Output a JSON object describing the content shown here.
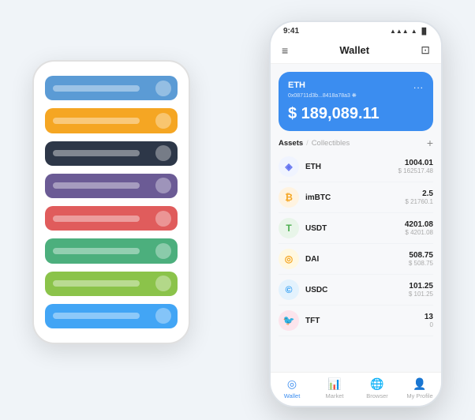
{
  "scene": {
    "back_phone": {
      "cards": [
        {
          "id": "card-1",
          "color_class": "card-blue"
        },
        {
          "id": "card-2",
          "color_class": "card-orange"
        },
        {
          "id": "card-3",
          "color_class": "card-dark"
        },
        {
          "id": "card-4",
          "color_class": "card-purple"
        },
        {
          "id": "card-5",
          "color_class": "card-red"
        },
        {
          "id": "card-6",
          "color_class": "card-green"
        },
        {
          "id": "card-7",
          "color_class": "card-light-green"
        },
        {
          "id": "card-8",
          "color_class": "card-light-blue"
        }
      ]
    },
    "front_phone": {
      "status_bar": {
        "time": "9:41",
        "signal": "▲",
        "wifi": "WiFi",
        "battery": "🔋"
      },
      "header": {
        "menu_icon": "≡",
        "title": "Wallet",
        "scan_icon": "⊡"
      },
      "eth_card": {
        "label": "ETH",
        "address": "0x08711d3b...8418a78a3  ❋",
        "dots": "...",
        "balance": "$ 189,089.11",
        "currency_symbol": "$"
      },
      "assets": {
        "tab_active": "Assets",
        "tab_divider": "/",
        "tab_inactive": "Collectibles",
        "add_icon": "+"
      },
      "asset_list": [
        {
          "id": "eth",
          "name": "ETH",
          "icon": "◈",
          "icon_class": "icon-eth",
          "amount": "1004.01",
          "usd": "$ 162517.48"
        },
        {
          "id": "imbtc",
          "name": "imBTC",
          "icon": "₿",
          "icon_class": "icon-imbtc",
          "amount": "2.5",
          "usd": "$ 21760.1"
        },
        {
          "id": "usdt",
          "name": "USDT",
          "icon": "T",
          "icon_class": "icon-usdt",
          "amount": "4201.08",
          "usd": "$ 4201.08"
        },
        {
          "id": "dai",
          "name": "DAI",
          "icon": "◎",
          "icon_class": "icon-dai",
          "amount": "508.75",
          "usd": "$ 508.75"
        },
        {
          "id": "usdc",
          "name": "USDC",
          "icon": "©",
          "icon_class": "icon-usdc",
          "amount": "101.25",
          "usd": "$ 101.25"
        },
        {
          "id": "tft",
          "name": "TFT",
          "icon": "🐦",
          "icon_class": "icon-tft",
          "amount": "13",
          "usd": "0"
        }
      ],
      "bottom_nav": [
        {
          "id": "wallet",
          "icon": "◎",
          "label": "Wallet",
          "active": true
        },
        {
          "id": "market",
          "icon": "📊",
          "label": "Market",
          "active": false
        },
        {
          "id": "browser",
          "icon": "🌐",
          "label": "Browser",
          "active": false
        },
        {
          "id": "profile",
          "icon": "👤",
          "label": "My Profile",
          "active": false
        }
      ]
    }
  }
}
